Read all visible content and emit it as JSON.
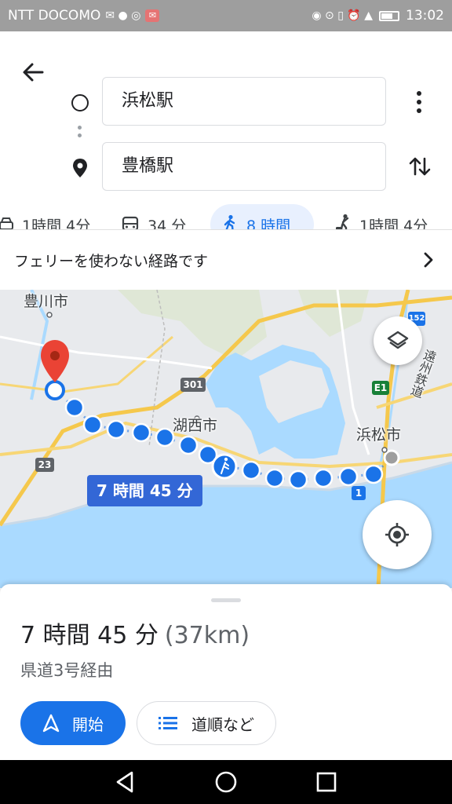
{
  "status_bar": {
    "carrier": "NTT DOCOMO",
    "time": "13:02"
  },
  "header": {
    "origin": "浜松駅",
    "destination": "豊橋駅"
  },
  "modes": [
    {
      "icon": "car-icon",
      "label": "1時間 4分",
      "active": false
    },
    {
      "icon": "bus-icon",
      "label": "34 分",
      "active": false
    },
    {
      "icon": "walk-icon",
      "label": "8 時間",
      "active": true
    },
    {
      "icon": "ride-icon",
      "label": "1時間 4分",
      "active": false
    }
  ],
  "notice": {
    "text": "フェリーを使わない経路です"
  },
  "map": {
    "labels": {
      "toyokawa": "豊川市",
      "kosai": "湖西市",
      "hamamatsu": "浜松市",
      "enshu": "遠州鉄道"
    },
    "shields": {
      "r301": "301",
      "r23": "23",
      "r1": "1",
      "e1": "E1",
      "r152": "152"
    },
    "route_chip": "7 時間 45 分"
  },
  "sheet": {
    "duration": "7 時間 45 分",
    "distance": "(37km)",
    "via": "県道3号経由",
    "start_label": "開始",
    "steps_label": "道順など"
  },
  "colors": {
    "accent": "#1a73e8",
    "route_dot": "#1a73e8",
    "route_chip": "#3367d6",
    "water": "#aadaff",
    "land": "#e8eaed",
    "pin": "#ea4335"
  }
}
